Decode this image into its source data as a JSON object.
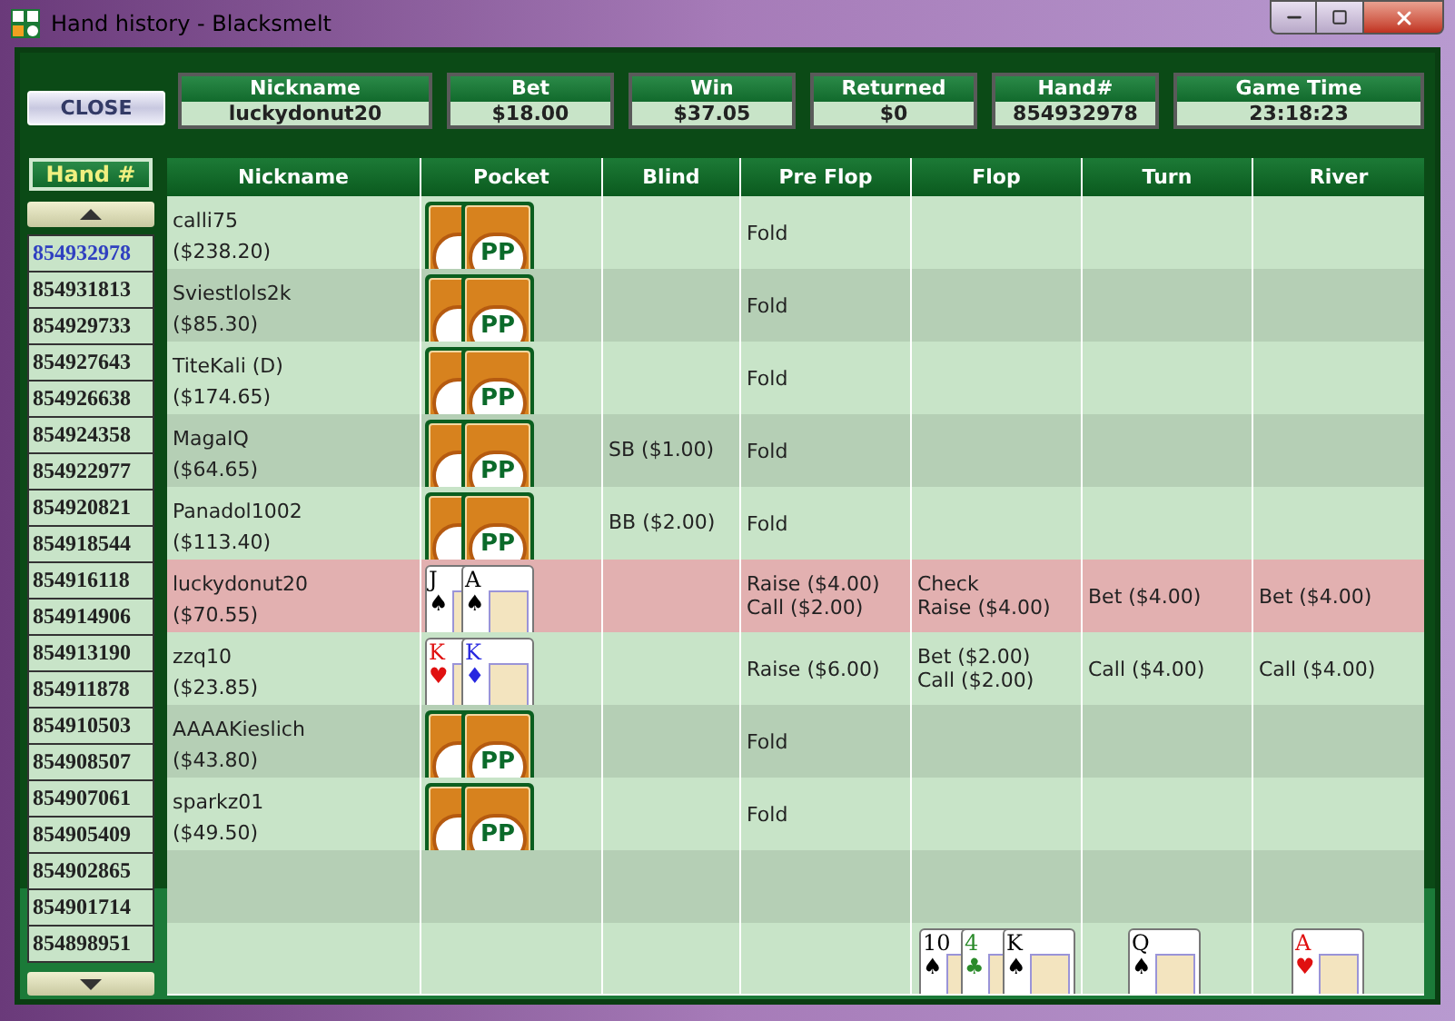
{
  "window": {
    "title": "Hand history - Blacksmelt"
  },
  "close_button": "CLOSE",
  "summary": [
    {
      "label": "Nickname",
      "value": "luckydonut20"
    },
    {
      "label": "Bet",
      "value": "$18.00"
    },
    {
      "label": "Win",
      "value": "$37.05"
    },
    {
      "label": "Returned",
      "value": "$0"
    },
    {
      "label": "Hand#",
      "value": "854932978"
    },
    {
      "label": "Game Time",
      "value": "23:18:23"
    }
  ],
  "hand_list": {
    "header": "Hand #",
    "items": [
      {
        "label": "854932978",
        "selected": true
      },
      {
        "label": "854931813",
        "selected": false
      },
      {
        "label": "854929733",
        "selected": false
      },
      {
        "label": "854927643",
        "selected": false
      },
      {
        "label": "854926638",
        "selected": false
      },
      {
        "label": "854924358",
        "selected": false
      },
      {
        "label": "854922977",
        "selected": false
      },
      {
        "label": "854920821",
        "selected": false
      },
      {
        "label": "854918544",
        "selected": false
      },
      {
        "label": "854916118",
        "selected": false
      },
      {
        "label": "854914906",
        "selected": false
      },
      {
        "label": "854913190",
        "selected": false
      },
      {
        "label": "854911878",
        "selected": false
      },
      {
        "label": "854910503",
        "selected": false
      },
      {
        "label": "854908507",
        "selected": false
      },
      {
        "label": "854907061",
        "selected": false
      },
      {
        "label": "854905409",
        "selected": false
      },
      {
        "label": "854902865",
        "selected": false
      },
      {
        "label": "854901714",
        "selected": false
      },
      {
        "label": "854898951",
        "selected": false
      }
    ]
  },
  "table": {
    "columns": [
      "Nickname",
      "Pocket",
      "Blind",
      "Pre Flop",
      "Flop",
      "Turn",
      "River"
    ],
    "rows": [
      {
        "kind": "player",
        "name": "calli75",
        "stack": "($238.20)",
        "highlighted": false,
        "pocket": [
          {
            "kind": "back"
          },
          {
            "kind": "back",
            "logo": "PP"
          }
        ],
        "preflop": [
          "Fold"
        ]
      },
      {
        "kind": "player",
        "name": "Sviestlols2k",
        "stack": "($85.30)",
        "highlighted": false,
        "pocket": [
          {
            "kind": "back"
          },
          {
            "kind": "back",
            "logo": "PP"
          }
        ],
        "preflop": [
          "Fold"
        ]
      },
      {
        "kind": "player",
        "name": "TiteKali (D)",
        "stack": "($174.65)",
        "highlighted": false,
        "pocket": [
          {
            "kind": "back"
          },
          {
            "kind": "back",
            "logo": "PP"
          }
        ],
        "preflop": [
          "Fold"
        ]
      },
      {
        "kind": "player",
        "name": "MagaIQ",
        "stack": "($64.65)",
        "highlighted": false,
        "pocket": [
          {
            "kind": "back"
          },
          {
            "kind": "back",
            "logo": "PP"
          }
        ],
        "blind": "SB ($1.00)",
        "preflop": [
          "Fold"
        ]
      },
      {
        "kind": "player",
        "name": "Panadol1002",
        "stack": "($113.40)",
        "highlighted": false,
        "pocket": [
          {
            "kind": "back"
          },
          {
            "kind": "back",
            "logo": "PP"
          }
        ],
        "blind": "BB ($2.00)",
        "preflop": [
          "Fold"
        ]
      },
      {
        "kind": "player",
        "name": "luckydonut20",
        "stack": "($70.55)",
        "highlighted": true,
        "pocket": [
          {
            "kind": "face",
            "rank": "J",
            "suit": "♠",
            "color": "#000000"
          },
          {
            "kind": "face",
            "rank": "A",
            "suit": "♠",
            "color": "#000000"
          }
        ],
        "preflop": [
          "Raise ($4.00)",
          "Call ($2.00)"
        ],
        "flop": [
          "Check",
          "Raise ($4.00)"
        ],
        "turn": [
          "Bet ($4.00)"
        ],
        "river": [
          "Bet ($4.00)"
        ]
      },
      {
        "kind": "player",
        "name": "zzq10",
        "stack": "($23.85)",
        "highlighted": false,
        "pocket": [
          {
            "kind": "face",
            "rank": "K",
            "suit": "♥",
            "color": "#e01010"
          },
          {
            "kind": "face",
            "rank": "K",
            "suit": "♦",
            "color": "#2828e0"
          }
        ],
        "preflop": [
          "Raise ($6.00)"
        ],
        "flop": [
          "Bet ($2.00)",
          "Call ($2.00)"
        ],
        "turn": [
          "Call ($4.00)"
        ],
        "river": [
          "Call ($4.00)"
        ]
      },
      {
        "kind": "player",
        "name": "AAAAKieslich",
        "stack": "($43.80)",
        "highlighted": false,
        "pocket": [
          {
            "kind": "back"
          },
          {
            "kind": "back",
            "logo": "PP"
          }
        ],
        "preflop": [
          "Fold"
        ]
      },
      {
        "kind": "player",
        "name": "sparkz01",
        "stack": "($49.50)",
        "highlighted": false,
        "pocket": [
          {
            "kind": "back"
          },
          {
            "kind": "back",
            "logo": "PP"
          }
        ],
        "preflop": [
          "Fold"
        ]
      },
      {
        "kind": "empty"
      },
      {
        "kind": "board",
        "flop": [
          {
            "kind": "face",
            "rank": "10",
            "suit": "♠",
            "color": "#000000"
          },
          {
            "kind": "face",
            "rank": "4",
            "suit": "♣",
            "color": "#2a8a2a"
          },
          {
            "kind": "face",
            "rank": "K",
            "suit": "♠",
            "color": "#000000"
          }
        ],
        "turn": [
          {
            "kind": "face",
            "rank": "Q",
            "suit": "♠",
            "color": "#000000"
          }
        ],
        "river": [
          {
            "kind": "face",
            "rank": "A",
            "suit": "♥",
            "color": "#e01010"
          }
        ]
      }
    ]
  }
}
